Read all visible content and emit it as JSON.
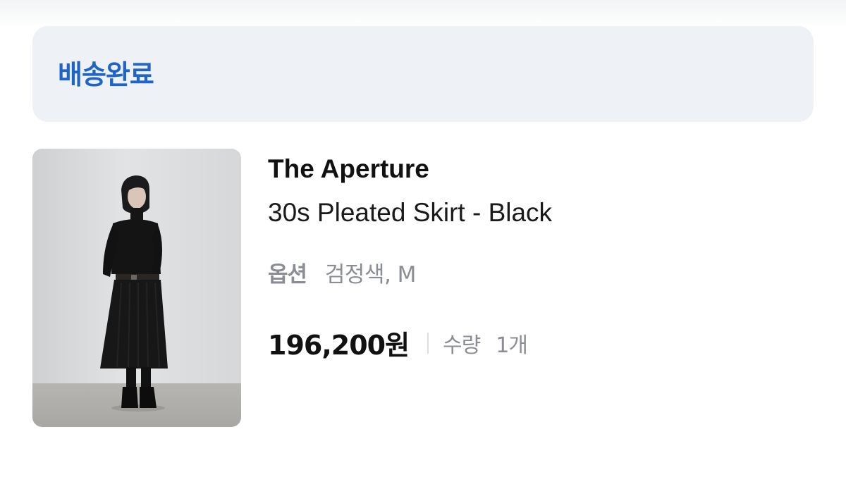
{
  "order": {
    "status_label": "배송완료"
  },
  "product": {
    "brand": "The Aperture",
    "name": "30s Pleated Skirt - Black",
    "option_label": "옵션",
    "option_value": "검정색, M",
    "price": "196,200원",
    "quantity_label": "수량",
    "quantity_value": "1개"
  },
  "colors": {
    "status_accent": "#1f64c8",
    "banner_background": "#eef2f7",
    "muted_text": "#8a8d93",
    "primary_text": "#111111"
  },
  "icons": {
    "thumbnail": "product-photo"
  }
}
